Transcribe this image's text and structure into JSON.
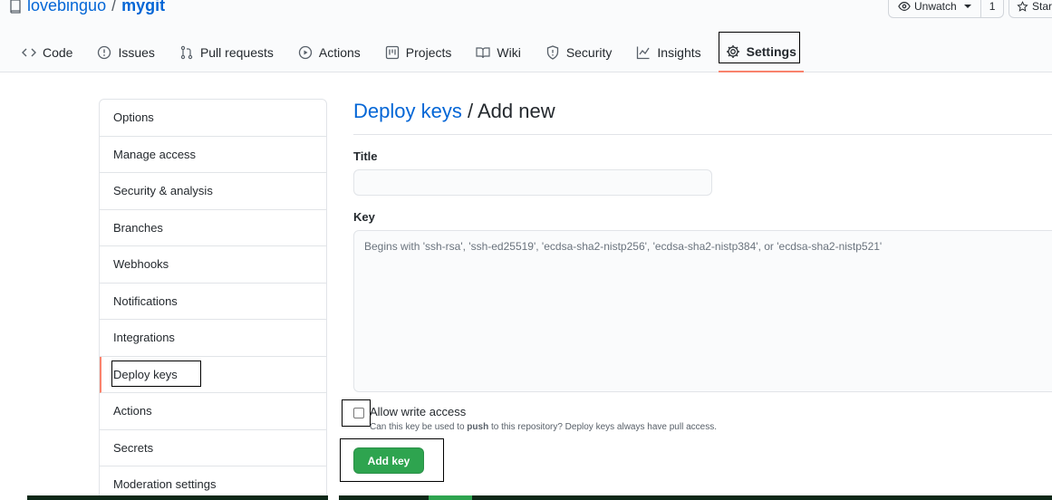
{
  "repo": {
    "owner": "lovebinguo",
    "separator": "/",
    "name": "mygit",
    "icon": "repo-icon"
  },
  "header_actions": {
    "watch_label": "Unwatch",
    "watch_count": "1",
    "star_label": "Star"
  },
  "tabs": [
    {
      "label": "Code",
      "icon": "code-icon"
    },
    {
      "label": "Issues",
      "icon": "issue-icon"
    },
    {
      "label": "Pull requests",
      "icon": "pull-request-icon"
    },
    {
      "label": "Actions",
      "icon": "play-icon"
    },
    {
      "label": "Projects",
      "icon": "project-icon"
    },
    {
      "label": "Wiki",
      "icon": "book-icon"
    },
    {
      "label": "Security",
      "icon": "shield-icon"
    },
    {
      "label": "Insights",
      "icon": "graph-icon"
    },
    {
      "label": "Settings",
      "icon": "gear-icon",
      "selected": true
    }
  ],
  "sidebar": {
    "items": [
      {
        "label": "Options"
      },
      {
        "label": "Manage access"
      },
      {
        "label": "Security & analysis"
      },
      {
        "label": "Branches"
      },
      {
        "label": "Webhooks"
      },
      {
        "label": "Notifications"
      },
      {
        "label": "Integrations"
      },
      {
        "label": "Deploy keys",
        "selected": true
      },
      {
        "label": "Actions"
      },
      {
        "label": "Secrets"
      },
      {
        "label": "Moderation settings"
      }
    ]
  },
  "main": {
    "title_link": "Deploy keys",
    "title_rest": " / Add new",
    "title_field_label": "Title",
    "title_value": "",
    "key_field_label": "Key",
    "key_placeholder": "Begins with 'ssh-rsa', 'ssh-ed25519', 'ecdsa-sha2-nistp256', 'ecdsa-sha2-nistp384', or 'ecdsa-sha2-nistp521'",
    "allow_write_label": "Allow write access",
    "allow_write_checked": false,
    "allow_write_note_prefix": "Can this key be used to ",
    "allow_write_note_bold": "push",
    "allow_write_note_suffix": " to this repository? Deploy keys always have pull access.",
    "submit_label": "Add key"
  },
  "colors": {
    "link": "#0366d6",
    "accent_underline": "#f9826c",
    "primary_button": "#2ea44f",
    "border": "#e1e4e8"
  }
}
